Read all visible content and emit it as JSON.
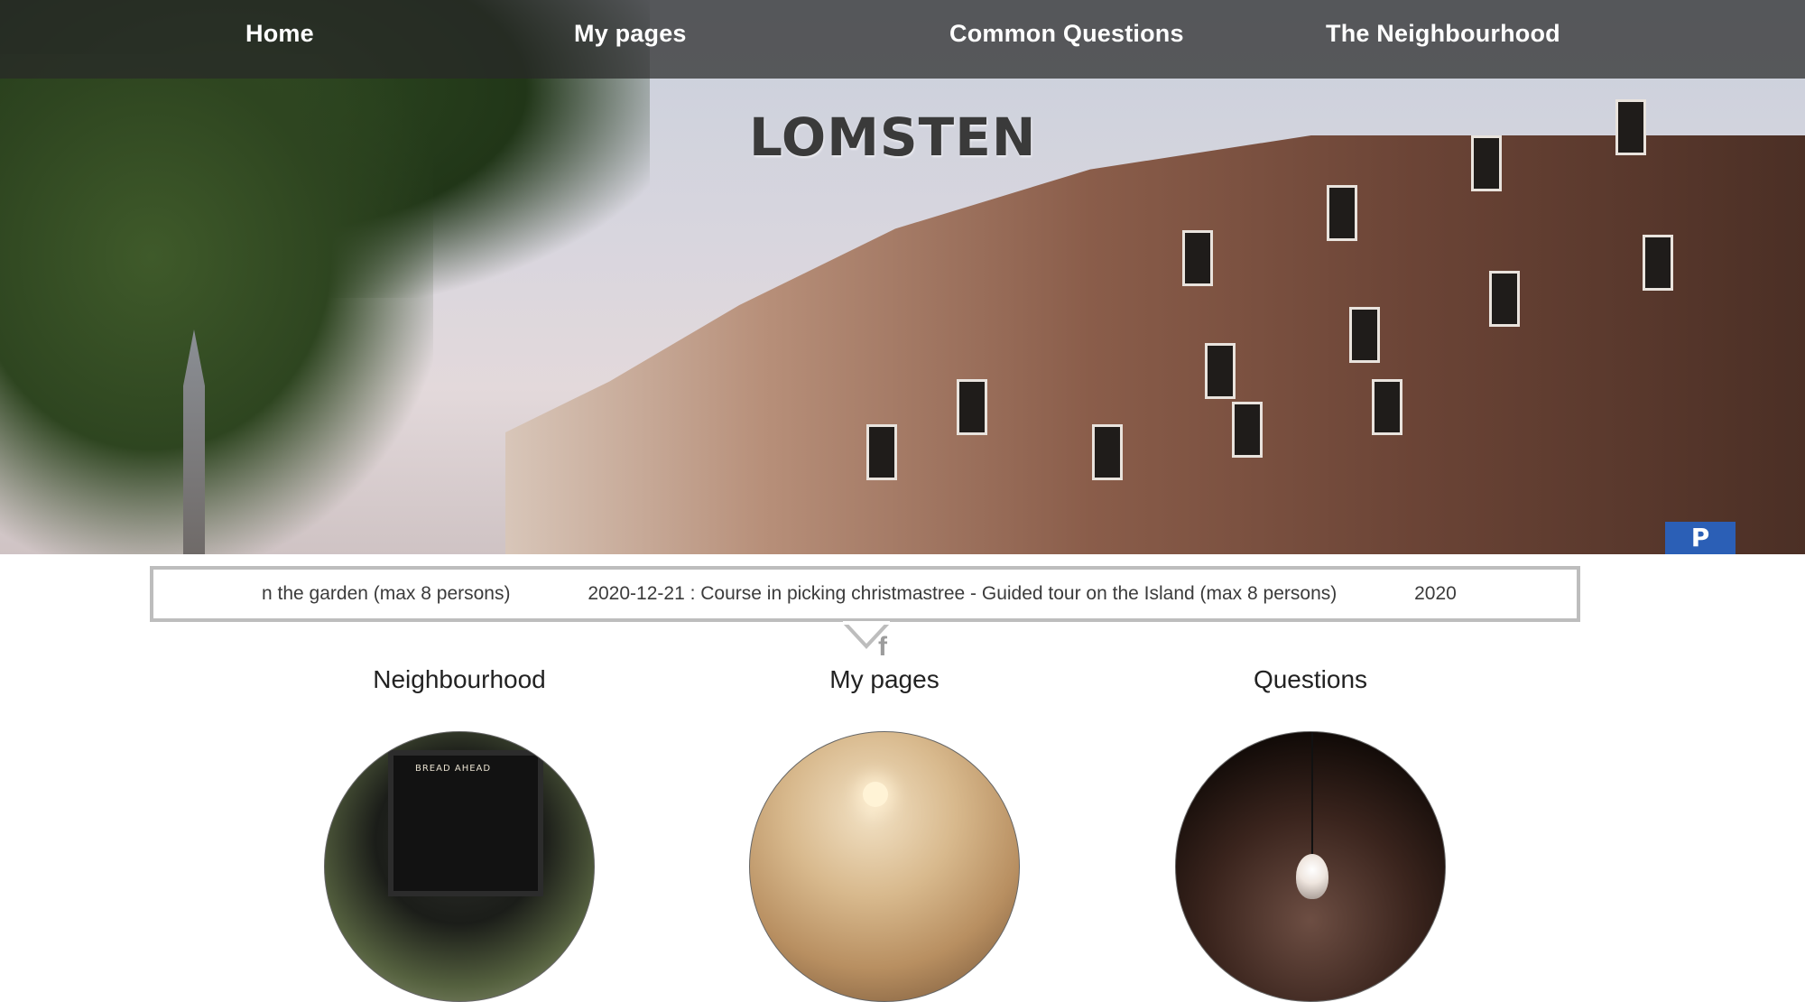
{
  "nav": {
    "items": [
      "Home",
      "My pages",
      "Common Questions",
      "The Neighbourhood"
    ]
  },
  "hero": {
    "title": "LOMSTEN",
    "sign_text": "P",
    "shop_sign": "BREAD AHEAD"
  },
  "ticker": {
    "items": [
      "n the garden (max 8 persons)",
      "2020-12-21 : Course in picking christmastree - Guided tour on the Island (max 8 persons)",
      "2020"
    ]
  },
  "social": {
    "facebook_label": "f"
  },
  "sections": [
    {
      "title": "Neighbourhood",
      "icon": "bakery-storefront-image"
    },
    {
      "title": "My pages",
      "icon": "living-room-image"
    },
    {
      "title": "Questions",
      "icon": "light-bulb-image"
    }
  ]
}
